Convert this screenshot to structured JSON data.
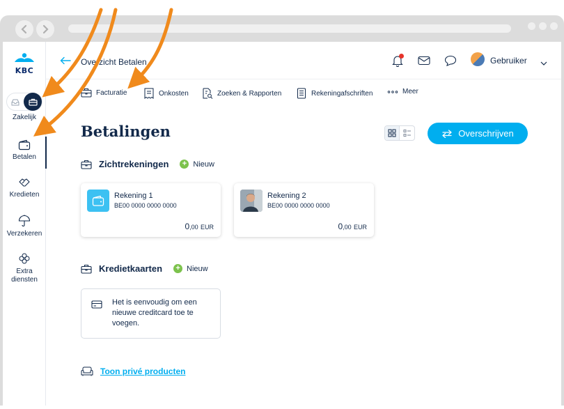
{
  "topbar": {
    "page_title": "Overzicht Betalen",
    "user_name": "Gebruiker"
  },
  "sidebar": {
    "items": [
      {
        "label": "Zakelijk"
      },
      {
        "label": "Betalen"
      },
      {
        "label": "Kredieten"
      },
      {
        "label": "Verzekeren"
      },
      {
        "label": "Extra diensten"
      }
    ],
    "logo_text": "KBC"
  },
  "subnav": {
    "items": [
      {
        "label": "Facturatie"
      },
      {
        "label": "Onkosten"
      },
      {
        "label": "Zoeken & Rapporten"
      },
      {
        "label": "Rekeningafschriften"
      },
      {
        "label": "Meer"
      }
    ]
  },
  "main": {
    "title": "Betalingen",
    "transfer_label": "Overschrijven",
    "current_accounts": {
      "title": "Zichtrekeningen",
      "new_label": "Nieuw",
      "accounts": [
        {
          "name": "Rekening 1",
          "iban": "BE00 0000 0000 0000",
          "amount_int": "0",
          "amount_dec": ",00",
          "currency": "EUR"
        },
        {
          "name": "Rekening 2",
          "iban": "BE00 0000 0000 0000",
          "amount_int": "0",
          "amount_dec": ",00",
          "currency": "EUR"
        }
      ]
    },
    "credit_cards": {
      "title": "Kredietkaarten",
      "new_label": "Nieuw",
      "empty_text": "Het is eenvoudig om een nieuwe creditcard toe te voegen."
    },
    "show_private_label": "Toon privé producten"
  },
  "colors": {
    "navy": "#12294a",
    "accent": "#00aeef",
    "green": "#7cc24c",
    "notification": "#e6332a",
    "annotation_arrow": "#f08a1c"
  }
}
